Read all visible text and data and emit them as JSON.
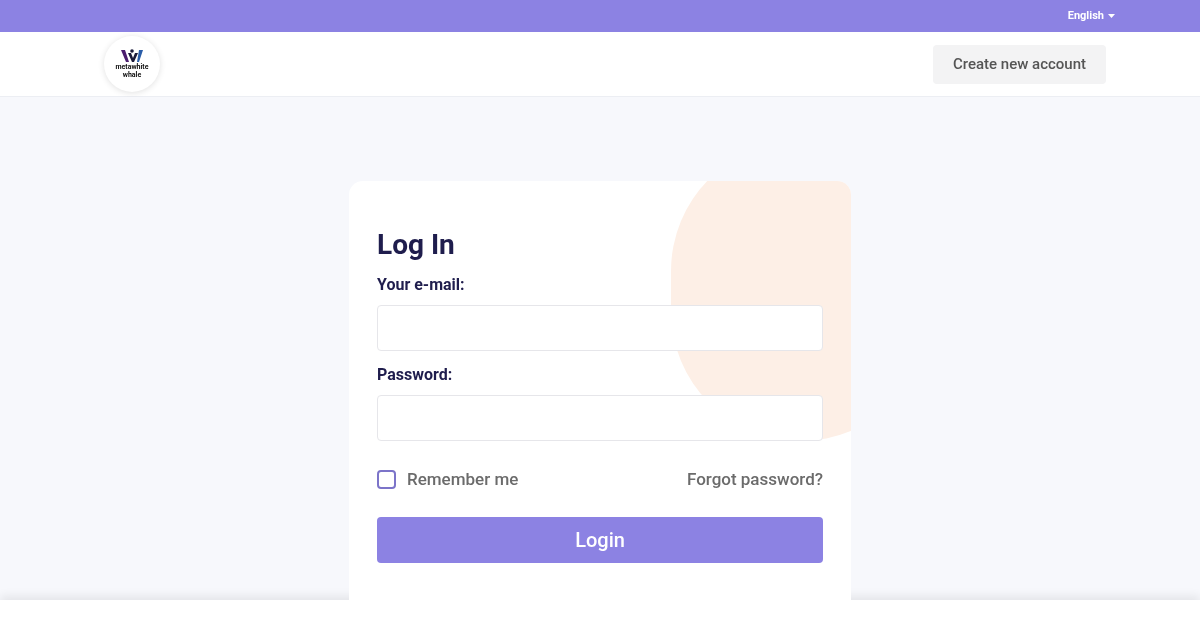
{
  "top_bar": {
    "language": "English"
  },
  "header": {
    "logo_text": [
      "metawhite",
      "whale"
    ],
    "create_account": "Create new account"
  },
  "login": {
    "title": "Log In",
    "fields": [
      {
        "label": "Your e-mail:"
      },
      {
        "label": "Password:"
      }
    ],
    "remember_me": {
      "label": "Remember me",
      "checked": false
    },
    "forgot_password": "Forgot password?",
    "submit": "Login"
  }
}
